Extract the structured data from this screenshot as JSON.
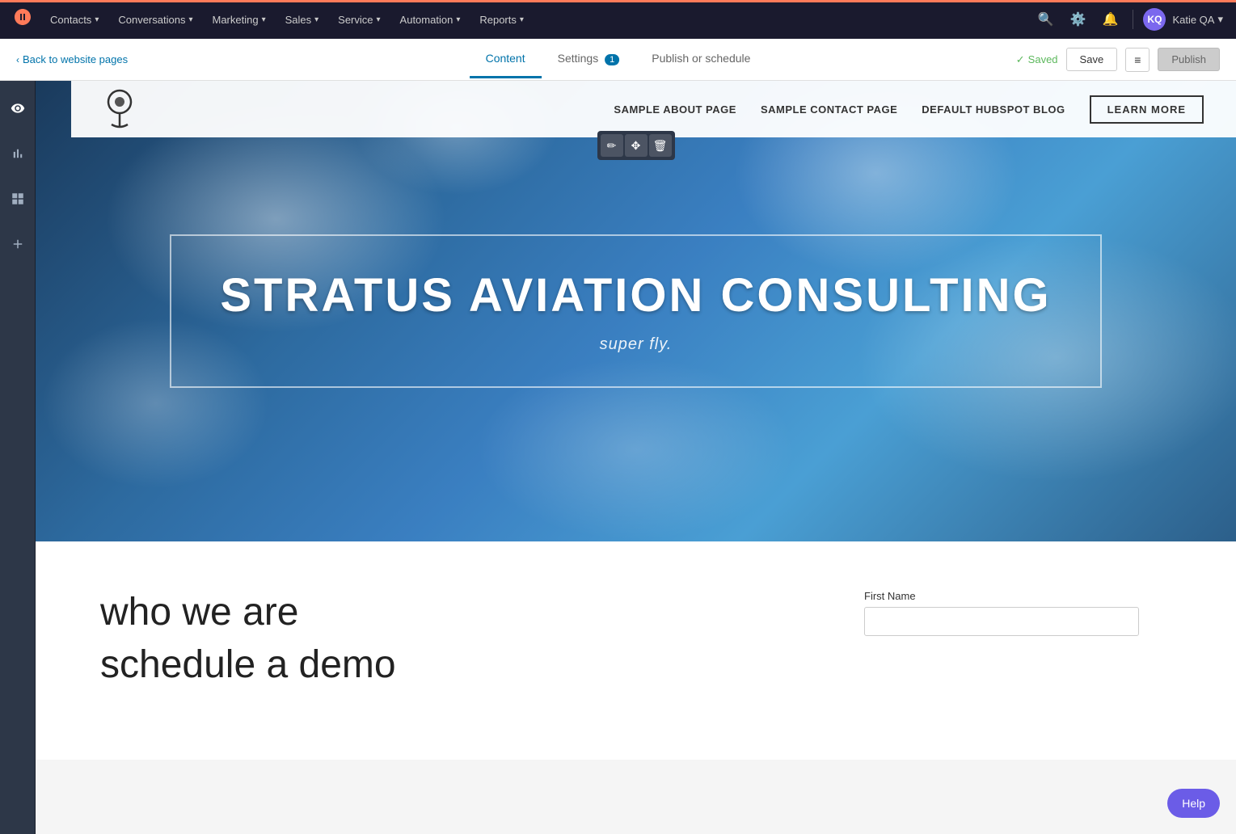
{
  "nav": {
    "logo": "H",
    "items": [
      {
        "label": "Contacts",
        "hasDropdown": true
      },
      {
        "label": "Conversations",
        "hasDropdown": true
      },
      {
        "label": "Marketing",
        "hasDropdown": true
      },
      {
        "label": "Sales",
        "hasDropdown": true
      },
      {
        "label": "Service",
        "hasDropdown": true
      },
      {
        "label": "Automation",
        "hasDropdown": true
      },
      {
        "label": "Reports",
        "hasDropdown": true
      }
    ],
    "user": {
      "name": "Katie QA",
      "initials": "KQ"
    }
  },
  "editor": {
    "back_label": "Back to website pages",
    "tabs": [
      {
        "label": "Content",
        "badge": null
      },
      {
        "label": "Settings",
        "badge": "1"
      },
      {
        "label": "Publish or schedule",
        "badge": null
      }
    ],
    "saved_label": "Saved",
    "save_button": "Save",
    "publish_button": "Publish"
  },
  "sidebar": {
    "icons": [
      {
        "name": "eye",
        "symbol": "👁"
      },
      {
        "name": "chart",
        "symbol": "📊"
      },
      {
        "name": "box",
        "symbol": "⬜"
      },
      {
        "name": "plus",
        "symbol": "+"
      }
    ]
  },
  "website": {
    "nav_links": [
      {
        "label": "SAMPLE ABOUT PAGE"
      },
      {
        "label": "SAMPLE CONTACT PAGE"
      },
      {
        "label": "DEFAULT HUBSPOT BLOG"
      }
    ],
    "nav_cta": "LEARN MORE",
    "hero": {
      "title": "STRATUS AVIATION CONSULTING",
      "subtitle": "super fly."
    },
    "below_hero": {
      "heading1": "who we are",
      "heading2": "schedule a demo",
      "form_label": "First Name"
    }
  },
  "help_button": "Help"
}
